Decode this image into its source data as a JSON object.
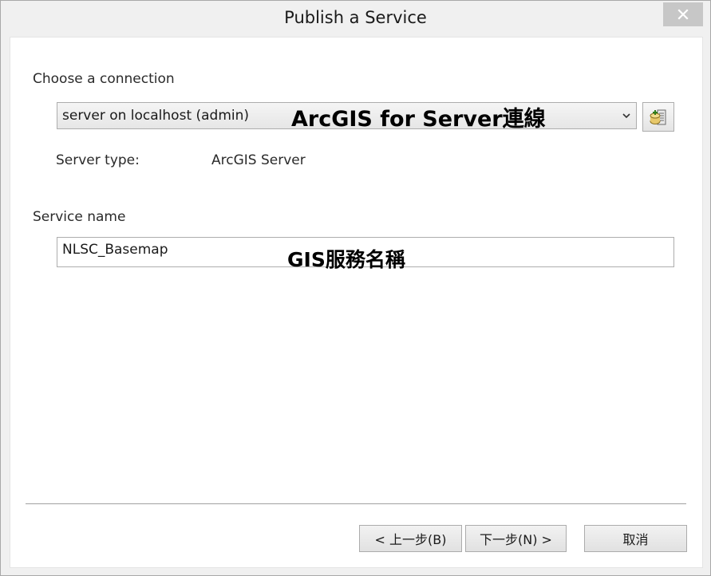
{
  "window": {
    "title": "Publish a Service",
    "close_glyph": "✕"
  },
  "connection": {
    "label": "Choose a connection",
    "selected": "server on localhost (admin)",
    "arrow_glyph": "⌄",
    "annotation": "ArcGIS for Server連線",
    "add_icon": "add-connection-icon"
  },
  "server_type": {
    "label": "Server type:",
    "value": "ArcGIS Server"
  },
  "service_name": {
    "label": "Service name",
    "value": "NLSC_Basemap",
    "annotation": "GIS服務名稱"
  },
  "buttons": {
    "back": "< 上一步(B)",
    "next": "下一步(N) >",
    "cancel": "取消"
  }
}
